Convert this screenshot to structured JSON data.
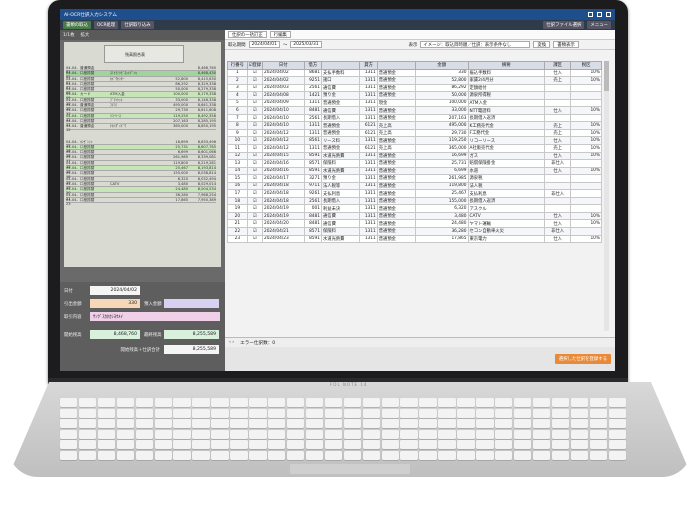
{
  "app": {
    "title": "AI-OCR仕訳入力システム",
    "toolbar_buttons": [
      "書類の取込",
      "OCR処理",
      "仕訳取り込み"
    ],
    "toolbar_right": [
      "仕訳ファイル選択",
      "メニュー"
    ]
  },
  "scan_toolbar": {
    "pages": "1/1枚",
    "zoom": "拡大"
  },
  "scan": {
    "header": "残高照合表",
    "rows": [
      [
        "04-04-01",
        "普通預金",
        "",
        "",
        "8,468,760"
      ],
      [
        "04-04-02",
        "口座振替",
        "ｽﾐﾄﾓﾐﾂﾋﾞﾈｯﾄﾃﾞﾝｷ",
        "",
        "8,468,430"
      ],
      [
        "04-04-02",
        "口座振替",
        "ｶﾄﾞｳｾﾝﾀｰ",
        "52,800",
        "8,415,630"
      ],
      [
        "04-04-03",
        "口座振替",
        "",
        "86,292",
        "8,329,338"
      ],
      [
        "04-04-08",
        "口座振替",
        "",
        "50,000",
        "8,279,338"
      ],
      [
        "04-04-09",
        "カード",
        "ATM入金",
        "100,000",
        "8,179,338"
      ],
      [
        "04-04-10",
        "口座振替",
        "ﾌﾞﾗﾝｹｯﾄ",
        "33,000",
        "8,146,338"
      ],
      [
        "04-04-10",
        "普通預金",
        "ﾌﾘｺﾐ",
        "495,000",
        "8,641,338"
      ],
      [
        "04-04-12",
        "口座振替",
        "",
        "29,730",
        "8,611,608"
      ],
      [
        "04-04-12",
        "口座振替",
        "ﾘｺｰﾘｰｽ",
        "119,250",
        "8,492,358"
      ],
      [
        "04-04-12",
        "口座振替",
        "",
        "207,163",
        "8,285,195"
      ],
      [
        "04-04-12",
        "普通預金",
        "ﾅｶﾉﾀﾞｲﾄﾞｳ",
        "365,000",
        "8,650,195"
      ]
    ],
    "rows2": [
      [
        "04-04-15",
        "ｵﾝｾﾞﾝｼｬ",
        "",
        "16,699",
        "8,633,496"
      ],
      [
        "04-04-16",
        "口座振替",
        "",
        "25,731",
        "8,607,765"
      ],
      [
        "04-04-16",
        "口座振替",
        "",
        "6,699",
        "8,601,066"
      ],
      [
        "04-04-17",
        "口座振替",
        "",
        "261,985",
        "8,339,081"
      ],
      [
        "04-04-18",
        "口座振替",
        "",
        "119,800",
        "8,219,281"
      ],
      [
        "04-04-18",
        "口座振替",
        "",
        "25,467",
        "8,193,814"
      ],
      [
        "04-04-18",
        "口座振替",
        "",
        "155,000",
        "8,038,814"
      ],
      [
        "04-04-19",
        "口座振替",
        "",
        "6,320",
        "8,032,494"
      ],
      [
        "04-04-19",
        "口座振替",
        "CATV",
        "3,480",
        "8,029,014"
      ],
      [
        "04-04-20",
        "口座振替",
        "",
        "24,480",
        "8,004,534"
      ],
      [
        "04-04-21",
        "口座振替",
        "",
        "36,280",
        "7,968,254"
      ],
      [
        "04-04-23",
        "口座振替",
        "",
        "17,865",
        "7,950,389"
      ]
    ]
  },
  "form": {
    "date_label": "日付",
    "date_value": "2024/04/02",
    "out_label": "引出金額",
    "out_value": "330",
    "in_label": "預入金額",
    "in_value": "",
    "desc_label": "取引内容",
    "desc_value": "ｻﾝｸﾞｽｶﾀｶｼﾖｳﾒｲ",
    "open_label": "開始残高",
    "open_value": "8,468,760",
    "close_label": "最終残高",
    "close_value": "8,255,589",
    "calc_label": "開始残高＋仕訳合計",
    "calc_value": "8,255,589"
  },
  "right": {
    "tool1": "仕訳の一括訂正",
    "tool2": "行編集",
    "period_label": "取込期間",
    "from": "2024/04/01",
    "to": "2025/03/31",
    "display_label": "表示",
    "display_value": "イメージ：取込目時順／仕訳：表示条件なし",
    "run": "変換",
    "view": "書類表示",
    "headers": [
      "行番号",
      "☑登録",
      "日付",
      "借方",
      "",
      "貸方",
      "",
      "金額",
      "摘要",
      "課区",
      "税区"
    ],
    "rows": [
      [
        "1",
        "☑",
        "2024/04/02",
        "8681",
        "支払手数料",
        "1311",
        "普通預金",
        "330",
        "振込手数料",
        "仕入",
        "10%"
      ],
      [
        "2",
        "☑",
        "2024/04/02",
        "9251",
        "諸口",
        "1311",
        "普通預金",
        "52,800",
        "家賃2/4月分",
        "売上",
        "10%"
      ],
      [
        "3",
        "☑",
        "2024/04/03",
        "2561",
        "通信費",
        "1311",
        "普通預金",
        "86,292",
        "定額給付",
        "",
        ""
      ],
      [
        "4",
        "☑",
        "2024/04/08",
        "1421",
        "預り金",
        "1311",
        "普通預金",
        "50,000",
        "源泉所得税",
        "",
        ""
      ],
      [
        "5",
        "☑",
        "2024/04/09",
        "1311",
        "普通預金",
        "1311",
        "現金",
        "100,000",
        "ATM入金",
        "",
        ""
      ],
      [
        "6",
        "☑",
        "2024/04/10",
        "8481",
        "通信費",
        "1311",
        "普通預金",
        "33,000",
        "NTT電話料",
        "仕入",
        "10%"
      ],
      [
        "7",
        "☑",
        "2024/04/10",
        "2561",
        "長期借入",
        "1311",
        "普通預金",
        "207,163",
        "長期借入返済",
        "",
        ""
      ],
      [
        "8",
        "☑",
        "2024/04/10",
        "1311",
        "普通預金",
        "6121",
        "売上高",
        "495,000",
        "K工務売代金",
        "売上",
        "10%"
      ],
      [
        "9",
        "☑",
        "2024/04/12",
        "1311",
        "普通預金",
        "6121",
        "売上高",
        "29,730",
        "F工務代金",
        "売上",
        "10%"
      ],
      [
        "10",
        "☑",
        "2024/04/12",
        "8561",
        "リース料",
        "1311",
        "普通預金",
        "119,250",
        "リコーリース",
        "仕入",
        "10%"
      ],
      [
        "11",
        "☑",
        "2024/04/12",
        "1311",
        "普通預金",
        "6121",
        "売上高",
        "365,000",
        "A社販売代金",
        "売上",
        "10%"
      ],
      [
        "12",
        "☑",
        "2024/04/15",
        "8591",
        "水道光熱費",
        "1311",
        "普通預金",
        "16,699",
        "ガス",
        "仕入",
        "10%"
      ],
      [
        "13",
        "☑",
        "2024/04/16",
        "8571",
        "保険料",
        "1311",
        "普通預金",
        "25,731",
        "賠償保険掛金",
        "非仕入",
        ""
      ],
      [
        "14",
        "☑",
        "2024/04/16",
        "8591",
        "水道光熱費",
        "1311",
        "普通預金",
        "6,699",
        "水道",
        "仕入",
        "10%"
      ],
      [
        "15",
        "☑",
        "2024/04/17",
        "3271",
        "預り金",
        "1311",
        "普通預金",
        "261,985",
        "源泉税",
        "",
        ""
      ],
      [
        "16",
        "☑",
        "2024/04/18",
        "9711",
        "法人税等",
        "1311",
        "普通預金",
        "119,800",
        "法人税",
        "",
        ""
      ],
      [
        "17",
        "☑",
        "2024/04/18",
        "9261",
        "支払利息",
        "1311",
        "普通預金",
        "25,467",
        "支払利息",
        "非仕入",
        ""
      ],
      [
        "18",
        "☑",
        "2024/04/18",
        "2561",
        "長期借入",
        "1311",
        "普通預金",
        "155,000",
        "長期借入返済",
        "",
        ""
      ],
      [
        "19",
        "☑",
        "2024/04/19",
        "001",
        "利益未決",
        "1311",
        "普通預金",
        "6,320",
        "アスクル",
        "",
        ""
      ],
      [
        "20",
        "☑",
        "2024/04/19",
        "8481",
        "通信費",
        "1311",
        "普通預金",
        "3,480",
        "CATV",
        "仕入",
        "10%"
      ],
      [
        "21",
        "☑",
        "2024/04/20",
        "8481",
        "通信費",
        "1311",
        "普通預金",
        "24,480",
        "ヤマト運輸",
        "仕入",
        "10%"
      ],
      [
        "22",
        "☑",
        "2024/04/21",
        "8571",
        "保険料",
        "1311",
        "普通預金",
        "36,280",
        "セコン自動車火災",
        "非仕入",
        ""
      ],
      [
        "23",
        "☑",
        "2024/04/23",
        "8591",
        "水道光熱費",
        "1311",
        "普通預金",
        "17,865",
        "東京電力",
        "仕入",
        "10%"
      ]
    ],
    "error_label": "エラー仕訳数：0",
    "register_button": "選択した仕訳を登録する"
  },
  "brand": "FOL NOTE 14"
}
